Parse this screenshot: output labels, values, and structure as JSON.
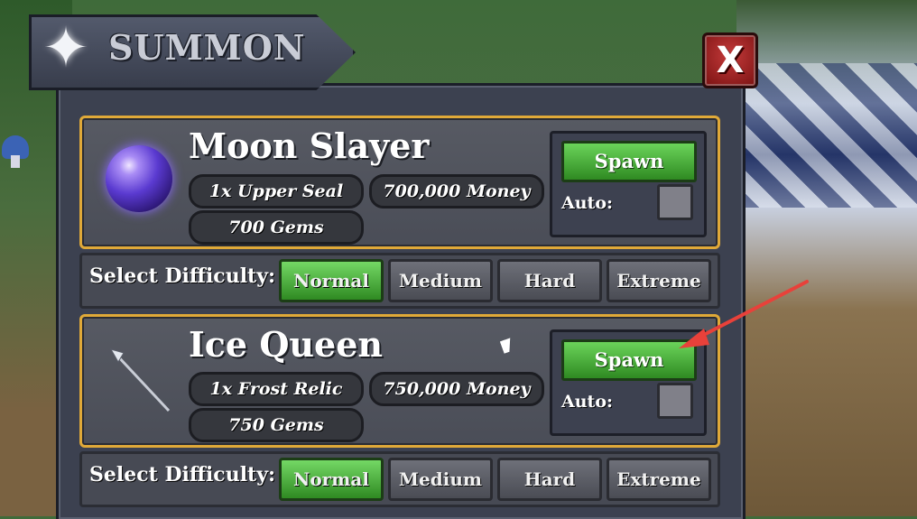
{
  "header": {
    "title": "SUMMON",
    "close_label": "X"
  },
  "bosses": [
    {
      "name": "Moon Slayer",
      "costs": [
        "1x Upper Seal",
        "700,000 Money",
        "700 Gems"
      ],
      "spawn_label": "Spawn",
      "auto_label": "Auto:",
      "icon": "purple-orb-icon"
    },
    {
      "name": "Ice Queen",
      "costs": [
        "1x Frost Relic",
        "750,000 Money",
        "750 Gems"
      ],
      "spawn_label": "Spawn",
      "auto_label": "Auto:",
      "icon": "spear-icon"
    }
  ],
  "difficulty": {
    "label": "Select Difficulty:",
    "options": [
      "Normal",
      "Medium",
      "Hard",
      "Extreme"
    ],
    "selected": "Normal"
  },
  "colors": {
    "card_border": "#e0a938",
    "active_green": "#4caf3a",
    "annotation_arrow": "#e8413a"
  }
}
